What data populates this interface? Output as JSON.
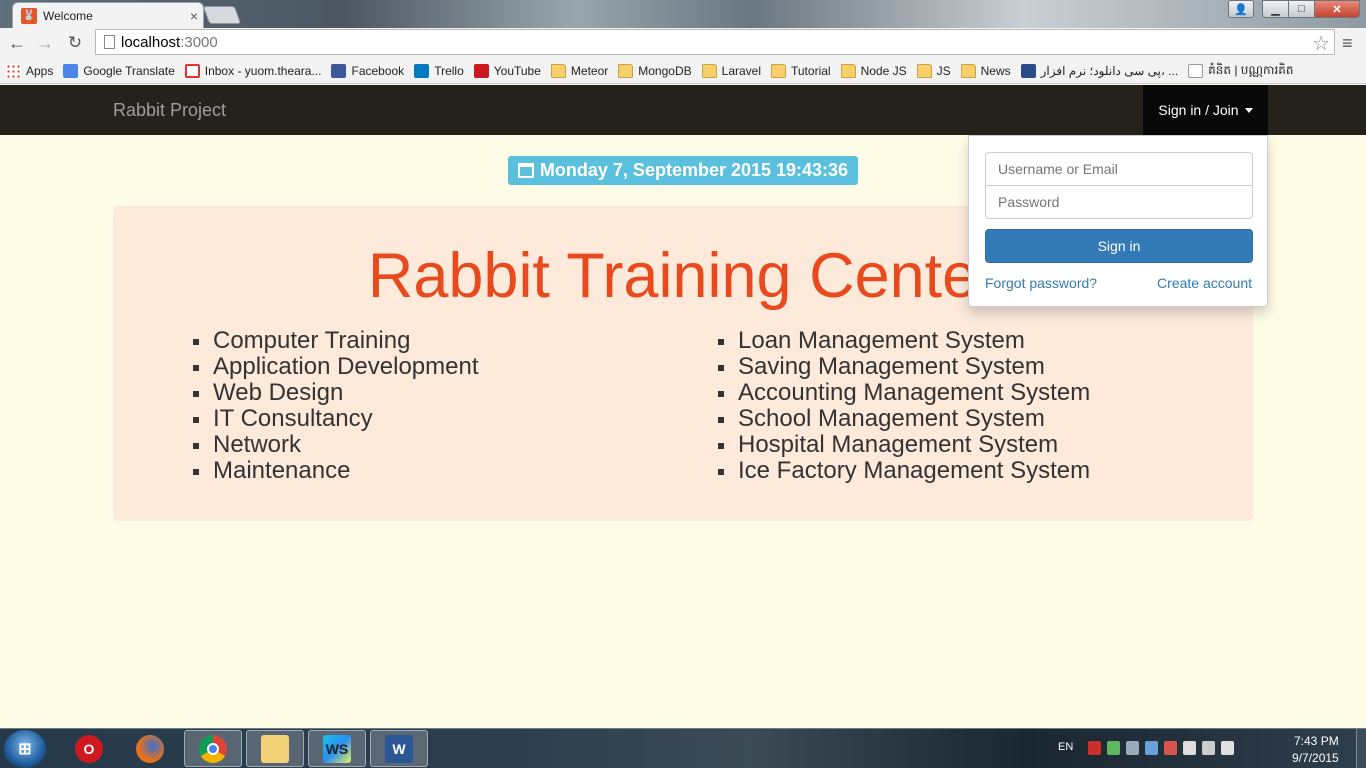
{
  "browser": {
    "tab_title": "Welcome",
    "tab_close": "×",
    "url_host": "localhost",
    "url_port": ":3000",
    "window_controls": {
      "minimize": "▁",
      "maximize": "□",
      "close": "✕"
    },
    "bookmarks": [
      {
        "label": "Apps",
        "icon": "apps-icon"
      },
      {
        "label": "Google Translate",
        "icon": "google-translate-icon"
      },
      {
        "label": "Inbox - yuom.theara...",
        "icon": "gmail-icon"
      },
      {
        "label": "Facebook",
        "icon": "facebook-icon"
      },
      {
        "label": "Trello",
        "icon": "trello-icon"
      },
      {
        "label": "YouTube",
        "icon": "youtube-icon"
      },
      {
        "label": "Meteor",
        "icon": "folder-icon"
      },
      {
        "label": "MongoDB",
        "icon": "folder-icon"
      },
      {
        "label": "Laravel",
        "icon": "folder-icon"
      },
      {
        "label": "Tutorial",
        "icon": "folder-icon"
      },
      {
        "label": "Node JS",
        "icon": "folder-icon"
      },
      {
        "label": "JS",
        "icon": "folder-icon"
      },
      {
        "label": "News",
        "icon": "folder-icon"
      },
      {
        "label": "پی سی دانلود؛ نرم افزار، ...",
        "icon": "website-icon"
      },
      {
        "label": "គំនិត | បណ្ណការគិត",
        "icon": "page-icon"
      }
    ]
  },
  "navbar": {
    "brand": "Rabbit Project",
    "signin_label": "Sign in / Join"
  },
  "date_badge": "Monday 7, September 2015 19:43:36",
  "jumbotron": {
    "title": "Rabbit Training Center",
    "services_left": [
      "Computer Training",
      "Application Development",
      "Web Design",
      "IT Consultancy",
      "Network",
      "Maintenance"
    ],
    "services_right": [
      "Loan Management System",
      "Saving Management System",
      "Accounting Management System",
      "School Management System",
      "Hospital Management System",
      "Ice Factory Management System"
    ]
  },
  "login_dropdown": {
    "username_placeholder": "Username or Email",
    "password_placeholder": "Password",
    "signin_button": "Sign in",
    "forgot_password": "Forgot password?",
    "create_account": "Create account"
  },
  "taskbar": {
    "apps": [
      "opera",
      "firefox",
      "chrome",
      "windows-explorer",
      "webstorm",
      "word"
    ],
    "language": "EN",
    "time": "7:43 PM",
    "date": "9/7/2015"
  },
  "colors": {
    "accent_title": "#e8491d",
    "navbar_bg": "#25221c",
    "badge_bg": "#5bc0de",
    "button_primary": "#337ab7",
    "page_bg": "#fefce6",
    "jumbotron_bg": "#fdeadb"
  }
}
